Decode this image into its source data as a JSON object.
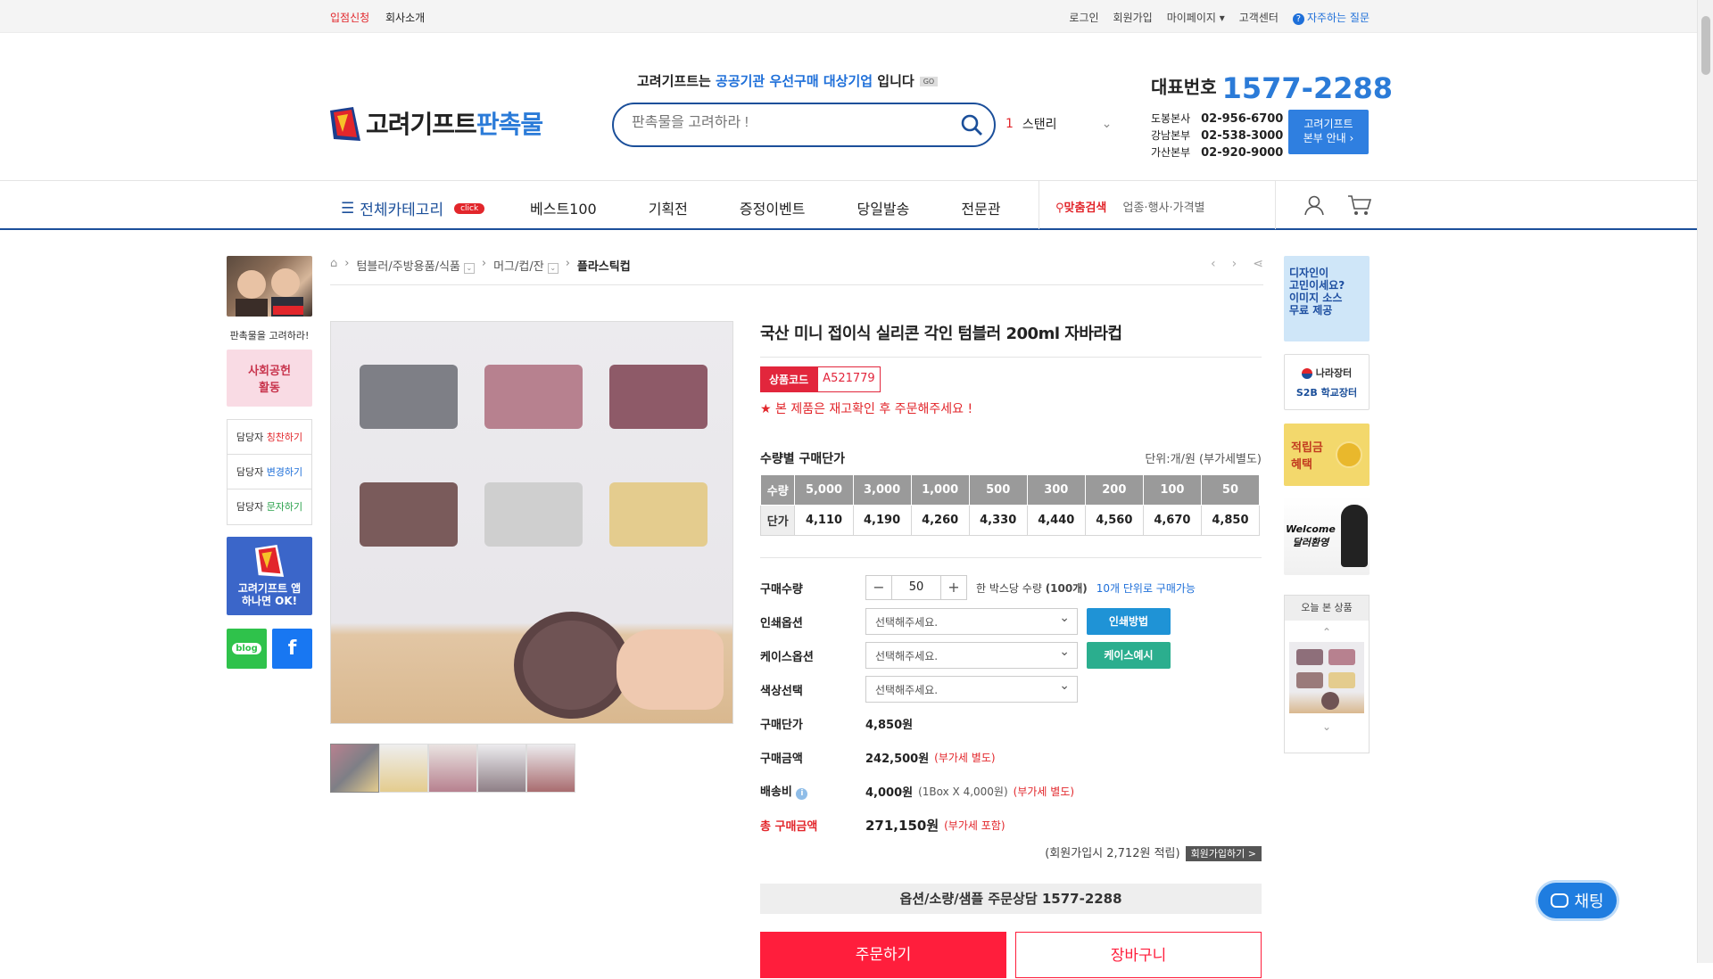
{
  "topbar": {
    "left": [
      "입점신청",
      "회사소개"
    ],
    "right": [
      "로그인",
      "회원가입",
      "마이페이지 ▾",
      "고객센터"
    ],
    "faq": "자주하는 질문"
  },
  "header": {
    "logo_main": "고려기프트",
    "logo_sub": "판촉물",
    "promo_prefix": "고려기프트는 ",
    "promo_highlight": "공공기관 우선구매 대상기업",
    "promo_suffix": " 입니다",
    "promo_go": "GO",
    "search_placeholder": "판촉물을 고려하라 !",
    "rank_num": "1",
    "rank_word": "스탠리",
    "phone_label": "대표번호",
    "phone_number": "1577-2288",
    "branches": [
      {
        "name": "도봉본사",
        "tel": "02-956-6700"
      },
      {
        "name": "강남본부",
        "tel": "02-538-3000"
      },
      {
        "name": "가산본부",
        "tel": "02-920-9000"
      }
    ],
    "guide_line1": "고려기프트",
    "guide_line2": "본부 안내 ›"
  },
  "nav": {
    "all_category": "전체카테고리",
    "click_badge": "click",
    "menu": [
      "베스트100",
      "기획전",
      "증정이벤트",
      "당일발송",
      "전문관"
    ],
    "fit_search": "맞춤검색",
    "fit_hint": "업종·행사·가격별"
  },
  "left_sidebar": {
    "portrait_caption": "판촉물을 고려하라!",
    "social": "사회공헌\n활동",
    "manager_links": [
      {
        "pre": "담당자 ",
        "em": "칭찬하기",
        "color": "#e2262b"
      },
      {
        "pre": "담당자 ",
        "em": "변경하기",
        "color": "#1e6fd9"
      },
      {
        "pre": "담당자 ",
        "em": "문자하기",
        "color": "#2ba24c"
      }
    ],
    "app_text1": "고려기프트 앱",
    "app_text2": "하나면 OK!",
    "blog": "blog",
    "facebook": "f"
  },
  "breadcrumb": {
    "items": [
      "텀블러/주방용품/식품",
      "머그/컵/잔"
    ],
    "current": "플라스틱컵"
  },
  "product": {
    "title": "국산 미니 접이식 실리콘 각인 텀블러 200ml 자바라컵",
    "code_label": "상품코드",
    "code": "A521779",
    "notice": "★ 본 제품은 재고확인 후 주문해주세요 !",
    "price_title": "수량별 구매단가",
    "price_unit": "단위:개/원 (부가세별도)",
    "price_table": {
      "qty_label": "수량",
      "price_label": "단가",
      "quantities": [
        "5,000",
        "3,000",
        "1,000",
        "500",
        "300",
        "200",
        "100",
        "50"
      ],
      "prices": [
        "4,110",
        "4,190",
        "4,260",
        "4,330",
        "4,440",
        "4,560",
        "4,670",
        "4,850"
      ]
    }
  },
  "order": {
    "qty_label": "구매수량",
    "qty_value": "50",
    "box_text": "한 박스당 수량 ",
    "box_qty": "(100개)",
    "unit_note": "10개 단위로 구매가능",
    "print_label": "인쇄옵션",
    "print_select": "선택해주세요.",
    "print_btn": "인쇄방법",
    "case_label": "케이스옵션",
    "case_select": "선택해주세요.",
    "case_btn": "케이스예시",
    "color_label": "색상선택",
    "color_select": "선택해주세요.",
    "unit_price_label": "구매단가",
    "unit_price": "4,850원",
    "amount_label": "구매금액",
    "amount": "242,500원",
    "vat_excl": "(부가세 별도)",
    "ship_label": "배송비",
    "ship": "4,000원",
    "ship_detail": "(1Box X 4,000원)",
    "total_label": "총 구매금액",
    "total": "271,150원",
    "vat_incl": "(부가세 포함)",
    "points": "(회원가입시 2,712원 적립)",
    "join_btn": "회원가입하기 >",
    "consult": "옵션/소량/샘플 주문상담  1577-2288",
    "buy": "주문하기",
    "cart": "장바구니"
  },
  "right_sidebar": {
    "design": "디자인이\n고민이세요?\n이미지 소스\n무료 제공",
    "naramarket": "나라장터",
    "s2b": "S2B 학교장터",
    "mileage": "적립금\n혜택",
    "welcome": "Welcome\n달러환영",
    "recent_title": "오늘 본 상품"
  },
  "chat": "채팅",
  "colors": {
    "brand_blue": "#1b4f9a",
    "accent_red": "#e2262b",
    "phone_blue": "#2b7bd8"
  }
}
